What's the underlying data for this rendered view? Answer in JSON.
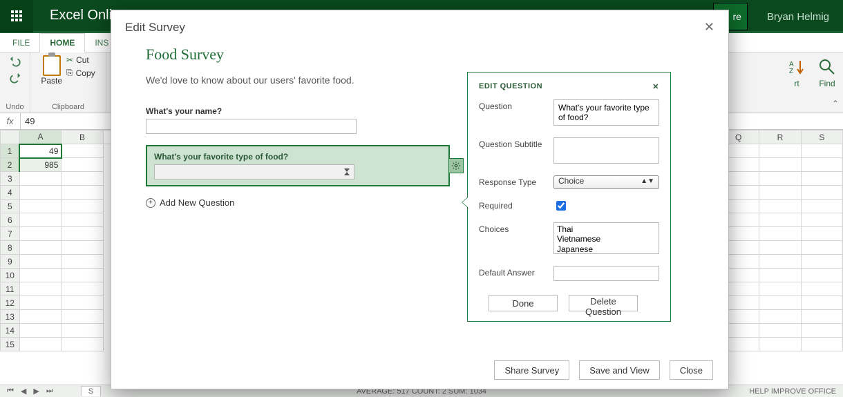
{
  "app": {
    "title": "Excel Online",
    "share_stub": "re",
    "user": "Bryan Helmig"
  },
  "tabs": {
    "file": "FILE",
    "home": "HOME",
    "ins": "INS"
  },
  "ribbon": {
    "undo_label": "Undo",
    "paste_label": "Paste",
    "cut_label": "Cut",
    "copy_label": "Copy",
    "clipboard_label": "Clipboard",
    "sort_stub": "rt",
    "find_label": "Find"
  },
  "formula": {
    "fx": "fx",
    "value": "49"
  },
  "grid": {
    "cols": [
      "A",
      "B",
      "Q",
      "R",
      "S"
    ],
    "rows": [
      1,
      2,
      3,
      4,
      5,
      6,
      7,
      8,
      9,
      10,
      11,
      12,
      13,
      14,
      15
    ],
    "a1": "49",
    "a2": "985"
  },
  "sheettabs": {
    "active_stub": "S"
  },
  "status": {
    "mid": "AVERAGE: 517   COUNT: 2   SUM: 1034",
    "right": "HELP IMPROVE OFFICE"
  },
  "dialog": {
    "title": "Edit Survey",
    "survey_title": "Food Survey",
    "survey_desc": "We'd love to know about our users' favorite food.",
    "q1_label": "What's your name?",
    "q2_label": "What's your favorite type of food?",
    "add_q": "Add New Question",
    "footer": {
      "share": "Share Survey",
      "save": "Save and View",
      "close": "Close"
    }
  },
  "editq": {
    "heading": "EDIT QUESTION",
    "labels": {
      "question": "Question",
      "subtitle": "Question Subtitle",
      "response": "Response Type",
      "required": "Required",
      "choices": "Choices",
      "default": "Default Answer"
    },
    "values": {
      "question": "What's your favorite type of food?",
      "subtitle": "",
      "response": "Choice",
      "required": true,
      "choices": "Thai\nVietnamese\nJapanese",
      "default": ""
    },
    "buttons": {
      "done": "Done",
      "delete": "Delete Question"
    }
  }
}
